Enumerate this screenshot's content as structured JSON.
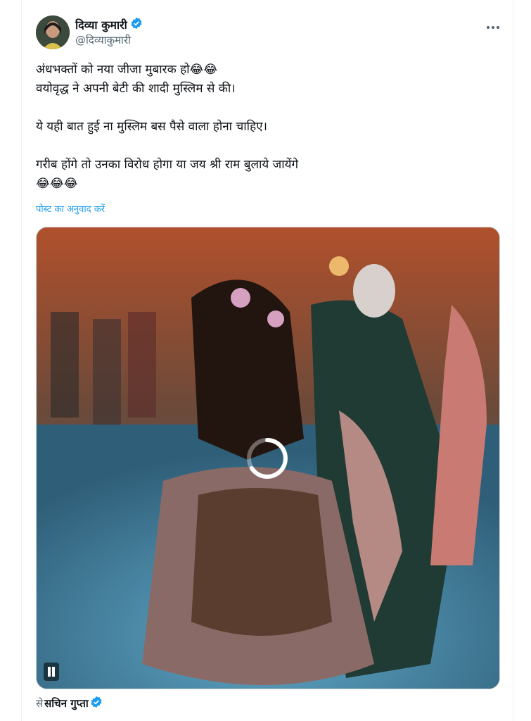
{
  "author": {
    "name": "दिव्या कुमारी",
    "handle": "@दिव्याकुमारी",
    "verified_color": "#1d9bf0"
  },
  "tweet": {
    "line1": "अंधभक्तों को नया जीजा मुबारक हो😂😂",
    "line2": "वयोवृद्ध ने अपनी बेटी की शादी मुस्लिम से की।",
    "line3": "ये यही बात हुई ना मुस्लिम बस पैसे वाला होना चाहिए।",
    "line4": "गरीब होंगे तो उनका विरोध होगा या जय श्री राम बुलाये जायेंगे",
    "line5": "😂😂😂"
  },
  "translate_label": "पोस्ट का अनुवाद करें",
  "media": {
    "type": "video",
    "state": "loading"
  },
  "source": {
    "prefix": "से",
    "name": "सचिन गुप्ता"
  },
  "icons": [
    "more-icon",
    "verified-badge-icon",
    "loading-spinner-icon",
    "pause-icon"
  ]
}
